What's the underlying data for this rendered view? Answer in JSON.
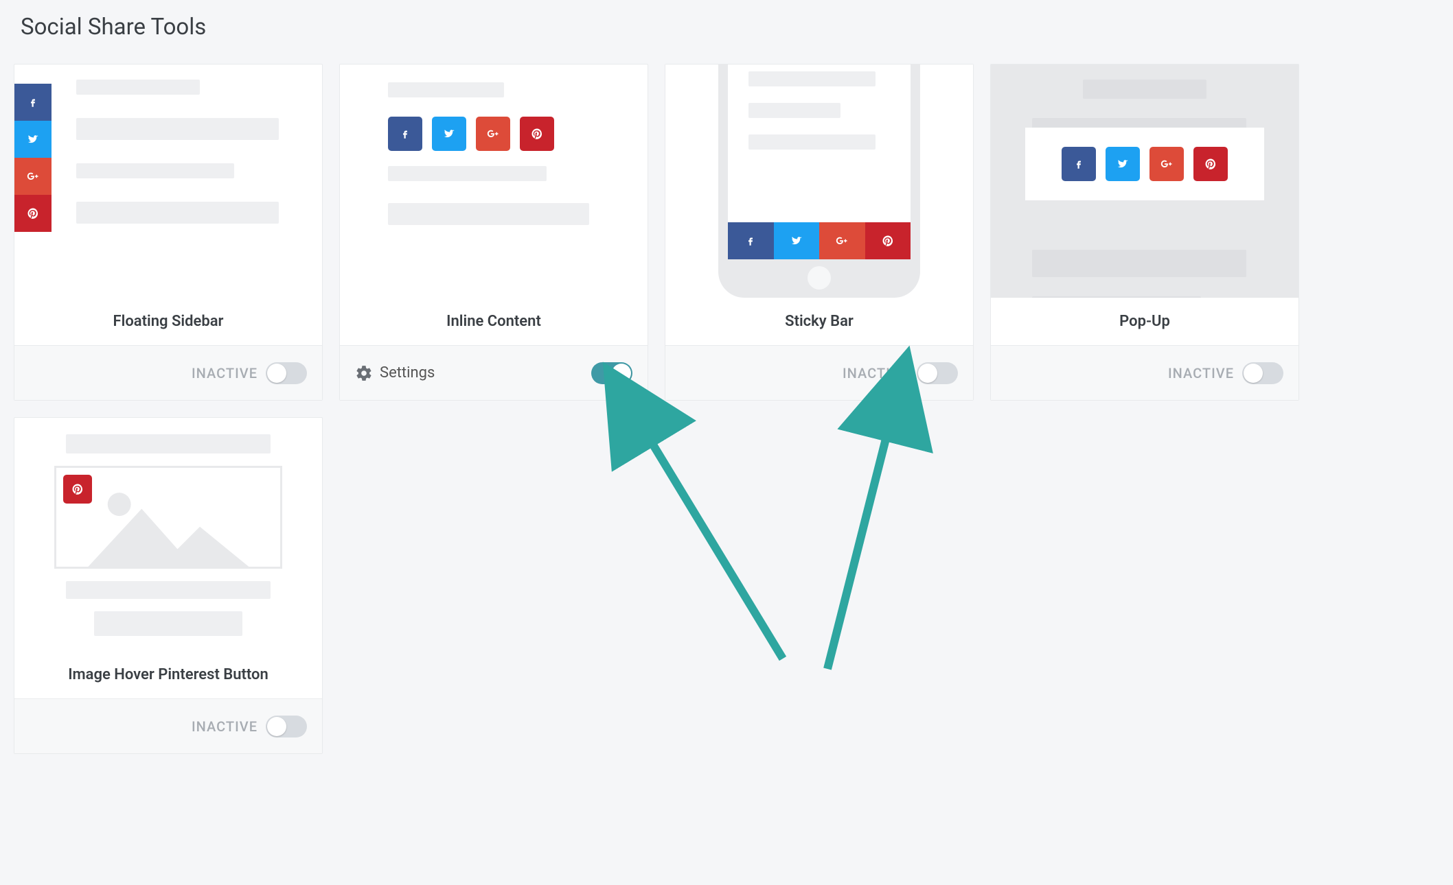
{
  "title": "Social Share Tools",
  "status": {
    "inactive_label": "INACTIVE",
    "settings_label": "Settings"
  },
  "cards": [
    {
      "id": "floating-sidebar",
      "title": "Floating Sidebar",
      "active": false
    },
    {
      "id": "inline-content",
      "title": "Inline Content",
      "active": true
    },
    {
      "id": "sticky-bar",
      "title": "Sticky Bar",
      "active": false
    },
    {
      "id": "pop-up",
      "title": "Pop-Up",
      "active": false
    },
    {
      "id": "image-hover-pinterest",
      "title": "Image Hover Pinterest Button",
      "active": false
    }
  ],
  "social_icons": {
    "facebook": "facebook",
    "twitter": "twitter",
    "googleplus": "googleplus",
    "pinterest": "pinterest"
  }
}
